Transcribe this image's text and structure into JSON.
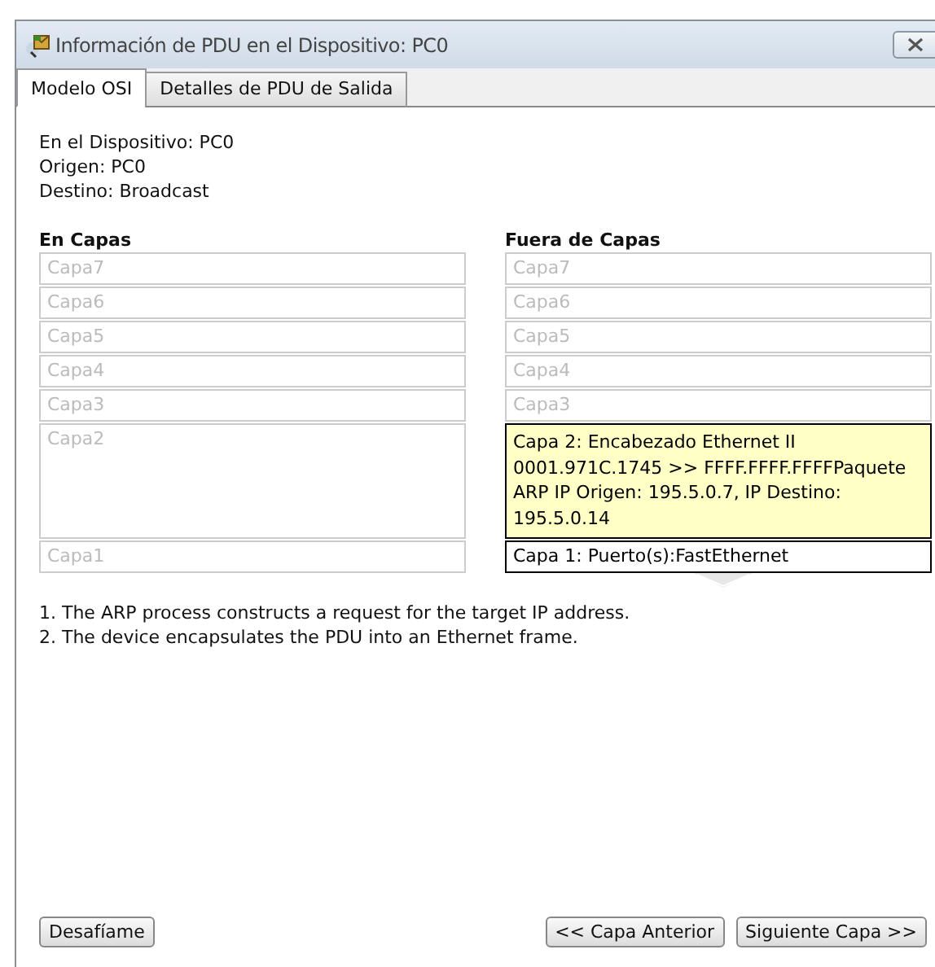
{
  "window": {
    "title": "Información de PDU en el Dispositivo: PC0"
  },
  "tabs": [
    {
      "label": "Modelo OSI",
      "selected": true
    },
    {
      "label": "Detalles de PDU de Salida",
      "selected": false
    }
  ],
  "info": [
    "En el Dispositivo: PC0",
    "Origen: PC0",
    "Destino: Broadcast"
  ],
  "columns": [
    {
      "heading": "En Capas",
      "layers": [
        {
          "label": "Capa7",
          "active": false,
          "highlighted": false
        },
        {
          "label": "Capa6",
          "active": false,
          "highlighted": false
        },
        {
          "label": "Capa5",
          "active": false,
          "highlighted": false
        },
        {
          "label": "Capa4",
          "active": false,
          "highlighted": false
        },
        {
          "label": "Capa3",
          "active": false,
          "highlighted": false
        },
        {
          "label": "Capa2",
          "active": false,
          "highlighted": false
        },
        {
          "label": "Capa1",
          "active": false,
          "highlighted": false
        }
      ]
    },
    {
      "heading": "Fuera de Capas",
      "layers": [
        {
          "label": "Capa7",
          "active": false,
          "highlighted": false
        },
        {
          "label": "Capa6",
          "active": false,
          "highlighted": false
        },
        {
          "label": "Capa5",
          "active": false,
          "highlighted": false
        },
        {
          "label": "Capa4",
          "active": false,
          "highlighted": false
        },
        {
          "label": "Capa3",
          "active": false,
          "highlighted": false
        },
        {
          "label": "Capa 2: Encabezado Ethernet II 0001.971C.1745 >> FFFF.FFFF.FFFFPaquete ARP IP Origen: 195.5.0.7, IP Destino: 195.5.0.14",
          "active": true,
          "highlighted": true
        },
        {
          "label": "Capa 1: Puerto(s):FastEthernet",
          "active": true,
          "highlighted": false
        }
      ]
    }
  ],
  "notes": [
    "1. The ARP process constructs a request for the target IP address.",
    "2. The device encapsulates the PDU into an Ethernet frame."
  ],
  "buttons_left": [
    "Desafíame"
  ],
  "buttons_right": [
    "<< Capa Anterior",
    "Siguiente Capa >>"
  ]
}
